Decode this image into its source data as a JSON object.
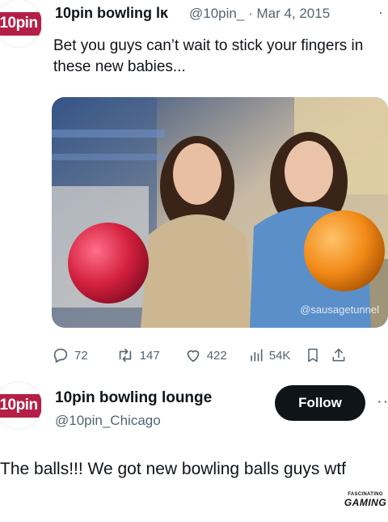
{
  "tweet": {
    "avatar_text": "10pin",
    "display_name": "10pin bowling lĸ",
    "handle": "@10pin_",
    "date": "Mar 4, 2015",
    "more_icon": "more-dots-icon",
    "text": "Bet you guys can’t wait to stick your fingers in these new babies...",
    "image_watermark": "@sausagetunnel",
    "stats": {
      "replies": "72",
      "retweets": "147",
      "likes": "422",
      "views": "54K"
    }
  },
  "account": {
    "avatar_text": "10pin",
    "display_name": "10pin bowling lounge",
    "handle": "@10pin_Chicago",
    "follow_label": "Follow"
  },
  "caption": "The balls!!! We got new bowling balls guys wtf",
  "watermark": {
    "line1": "FASCINATING",
    "line2": "GAMING"
  },
  "colors": {
    "brand_logo": "#b51f45",
    "text_primary": "#0f1419",
    "text_secondary": "#536471",
    "follow_button": "#0f1419"
  }
}
